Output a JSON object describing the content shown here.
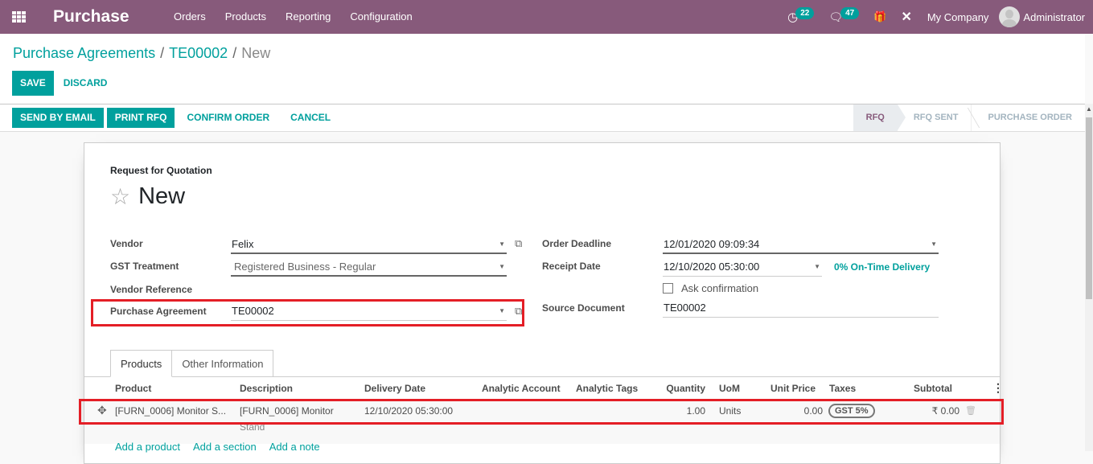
{
  "navbar": {
    "app_title": "Purchase",
    "menu": [
      "Orders",
      "Products",
      "Reporting",
      "Configuration"
    ],
    "activity_count": "22",
    "message_count": "47",
    "company": "My Company",
    "user": "Administrator"
  },
  "breadcrumb": {
    "items": [
      "Purchase Agreements",
      "TE00002"
    ],
    "separator": "/",
    "current": "New"
  },
  "actions": {
    "save": "Save",
    "discard": "Discard"
  },
  "statusbar": {
    "buttons": [
      "Send by Email",
      "Print RFQ",
      "Confirm Order",
      "Cancel"
    ],
    "stages": [
      "RFQ",
      "RFQ Sent",
      "Purchase Order"
    ],
    "current_stage": "RFQ"
  },
  "form": {
    "doc_type": "Request for Quotation",
    "title": "New",
    "vendor_label": "Vendor",
    "vendor_value": "Felix",
    "gst_label": "GST Treatment",
    "gst_value": "Registered Business - Regular",
    "vendor_ref_label": "Vendor Reference",
    "vendor_ref_value": "",
    "agreement_label": "Purchase Agreement",
    "agreement_value": "TE00002",
    "deadline_label": "Order Deadline",
    "deadline_value": "12/01/2020 09:09:34",
    "receipt_label": "Receipt Date",
    "receipt_value": "12/10/2020 05:30:00",
    "on_time": "0% On-Time Delivery",
    "ask_confirmation_label": "Ask confirmation",
    "ask_confirmation_checked": false,
    "source_label": "Source Document",
    "source_value": "TE00002"
  },
  "tabs": {
    "items": [
      "Products",
      "Other Information"
    ],
    "active": "Products"
  },
  "table": {
    "columns": [
      "Product",
      "Description",
      "Delivery Date",
      "Analytic Account",
      "Analytic Tags",
      "Quantity",
      "UoM",
      "Unit Price",
      "Taxes",
      "Subtotal"
    ],
    "rows": [
      {
        "product": "[FURN_0006] Monitor S...",
        "description_line1": "[FURN_0006] Monitor",
        "description_line2": "Stand",
        "delivery_date": "12/10/2020 05:30:00",
        "analytic_account": "",
        "analytic_tags": "",
        "quantity": "1.00",
        "uom": "Units",
        "unit_price": "0.00",
        "taxes": "GST 5%",
        "subtotal": "₹ 0.00"
      }
    ],
    "add_links": [
      "Add a product",
      "Add a section",
      "Add a note"
    ]
  },
  "colors": {
    "brand": "#875a7b",
    "accent": "#00a09d",
    "highlight": "#e41e26"
  }
}
